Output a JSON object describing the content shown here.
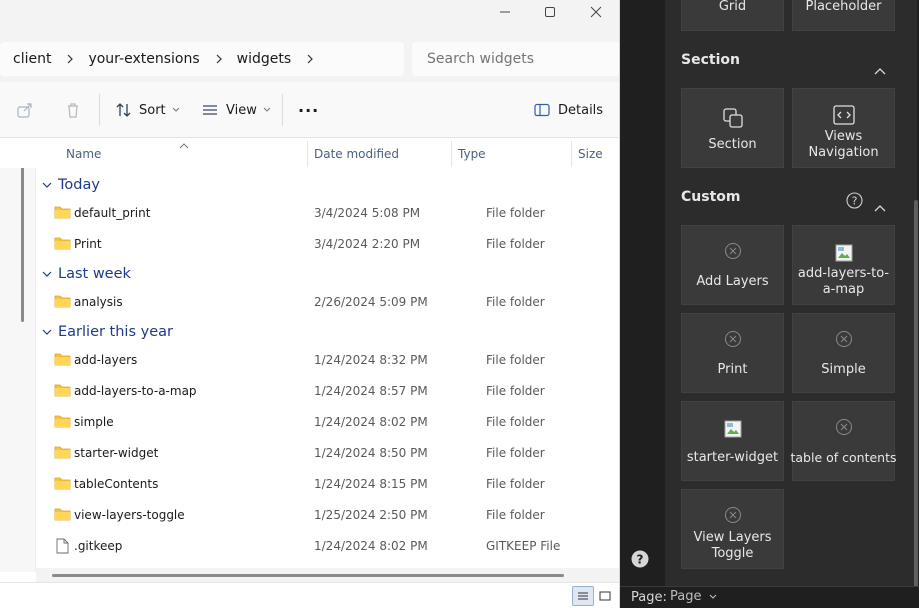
{
  "window": {
    "controls": {
      "minimize": "minimize-icon",
      "maximize": "maximize-icon",
      "close": "close-icon"
    }
  },
  "breadcrumb": [
    "client",
    "your-extensions",
    "widgets"
  ],
  "search": {
    "placeholder": "Search widgets"
  },
  "toolbar": {
    "sort_label": "Sort",
    "view_label": "View",
    "more_label": "···",
    "details_label": "Details"
  },
  "columns": {
    "name": "Name",
    "date": "Date modified",
    "type": "Type",
    "size": "Size"
  },
  "groups": [
    {
      "label": "Today"
    },
    {
      "label": "Last week"
    },
    {
      "label": "Earlier this year"
    }
  ],
  "files": [
    {
      "name": "default_print",
      "date": "3/4/2024 5:08 PM",
      "type": "File folder",
      "icon": "folder-icon"
    },
    {
      "name": "Print",
      "date": "3/4/2024 2:20 PM",
      "type": "File folder",
      "icon": "folder-icon"
    },
    {
      "name": "analysis",
      "date": "2/26/2024 5:09 PM",
      "type": "File folder",
      "icon": "folder-icon"
    },
    {
      "name": "add-layers",
      "date": "1/24/2024 8:32 PM",
      "type": "File folder",
      "icon": "folder-icon"
    },
    {
      "name": "add-layers-to-a-map",
      "date": "1/24/2024 8:57 PM",
      "type": "File folder",
      "icon": "folder-icon"
    },
    {
      "name": "simple",
      "date": "1/24/2024 8:02 PM",
      "type": "File folder",
      "icon": "folder-icon"
    },
    {
      "name": "starter-widget",
      "date": "1/24/2024 8:50 PM",
      "type": "File folder",
      "icon": "folder-icon"
    },
    {
      "name": "tableContents",
      "date": "1/24/2024 8:15 PM",
      "type": "File folder",
      "icon": "folder-icon"
    },
    {
      "name": "view-layers-toggle",
      "date": "1/25/2024 2:50 PM",
      "type": "File folder",
      "icon": "folder-icon"
    },
    {
      "name": ".gitkeep",
      "date": "1/24/2024 8:02 PM",
      "type": "GITKEEP File",
      "icon": "file-icon"
    }
  ],
  "panel": {
    "top_tiles": [
      "Grid",
      "Placeholder"
    ],
    "section_title": "Section",
    "section_tiles": [
      {
        "label": "Section",
        "icon": "section-icon"
      },
      {
        "label": "Views Navigation",
        "icon": "views-navigation-icon"
      }
    ],
    "custom_title": "Custom",
    "custom_tiles": [
      {
        "label": "Add Layers",
        "icon": "broken-x-icon"
      },
      {
        "label": "add-layers-to-a-map",
        "icon": "broken-image-icon"
      },
      {
        "label": "Print",
        "icon": "broken-x-icon"
      },
      {
        "label": "Simple",
        "icon": "broken-x-icon"
      },
      {
        "label": "starter-widget",
        "icon": "broken-image-icon"
      },
      {
        "label": "table of contents",
        "icon": "broken-x-icon"
      },
      {
        "label": "View Layers Toggle",
        "icon": "broken-x-icon"
      }
    ],
    "page_label": "Page:",
    "page_value": "Page"
  }
}
